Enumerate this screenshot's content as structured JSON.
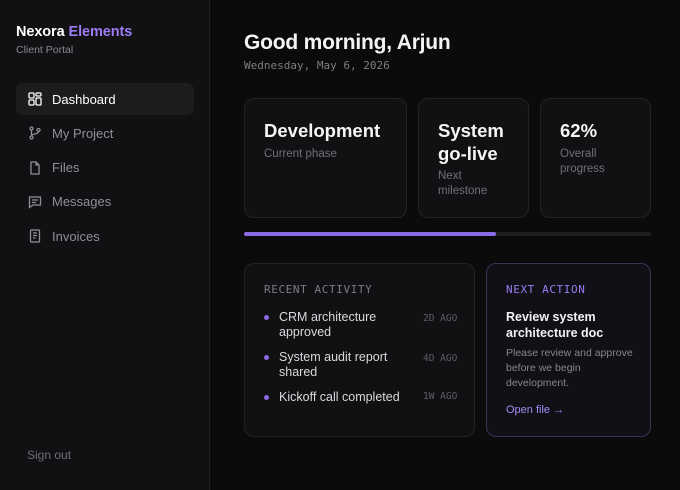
{
  "brand": {
    "name": "Nexora",
    "name_accent": "Elements",
    "subtitle": "Client Portal"
  },
  "nav": {
    "items": [
      {
        "label": "Dashboard",
        "icon": "dashboard-grid-icon",
        "active": true
      },
      {
        "label": "My Project",
        "icon": "git-branch-icon",
        "active": false
      },
      {
        "label": "Files",
        "icon": "file-icon",
        "active": false
      },
      {
        "label": "Messages",
        "icon": "message-icon",
        "active": false
      },
      {
        "label": "Invoices",
        "icon": "invoice-icon",
        "active": false
      }
    ],
    "signout": "Sign out"
  },
  "header": {
    "greeting": "Good morning, Arjun",
    "date": "Wednesday, May 6, 2026"
  },
  "stats": [
    {
      "title": "Development",
      "sub": "Current phase"
    },
    {
      "title": "System go-live",
      "title_lines": [
        "System",
        "go-live"
      ],
      "sub": "Next milestone",
      "sub_lines": [
        "Next",
        "milestone"
      ]
    },
    {
      "title": "62%",
      "sub": "Overall progress",
      "sub_lines": [
        "Overall",
        "progress"
      ]
    }
  ],
  "progress": {
    "value_percent": 62
  },
  "activity": {
    "heading": "RECENT ACTIVITY",
    "items": [
      {
        "text": "CRM architecture approved",
        "time": "2D AGO"
      },
      {
        "text": "System audit report shared",
        "time": "4D AGO"
      },
      {
        "text": "Kickoff call completed",
        "time": "1W AGO"
      }
    ]
  },
  "next_action": {
    "heading": "NEXT ACTION",
    "title": "Review system architecture doc",
    "description": "Please review and approve before we begin development.",
    "link": "Open file →"
  },
  "colors": {
    "accent": "#9b7cf3",
    "progress": "#8b6ae6",
    "background": "#0b0b0c",
    "sidebar": "#111113"
  }
}
